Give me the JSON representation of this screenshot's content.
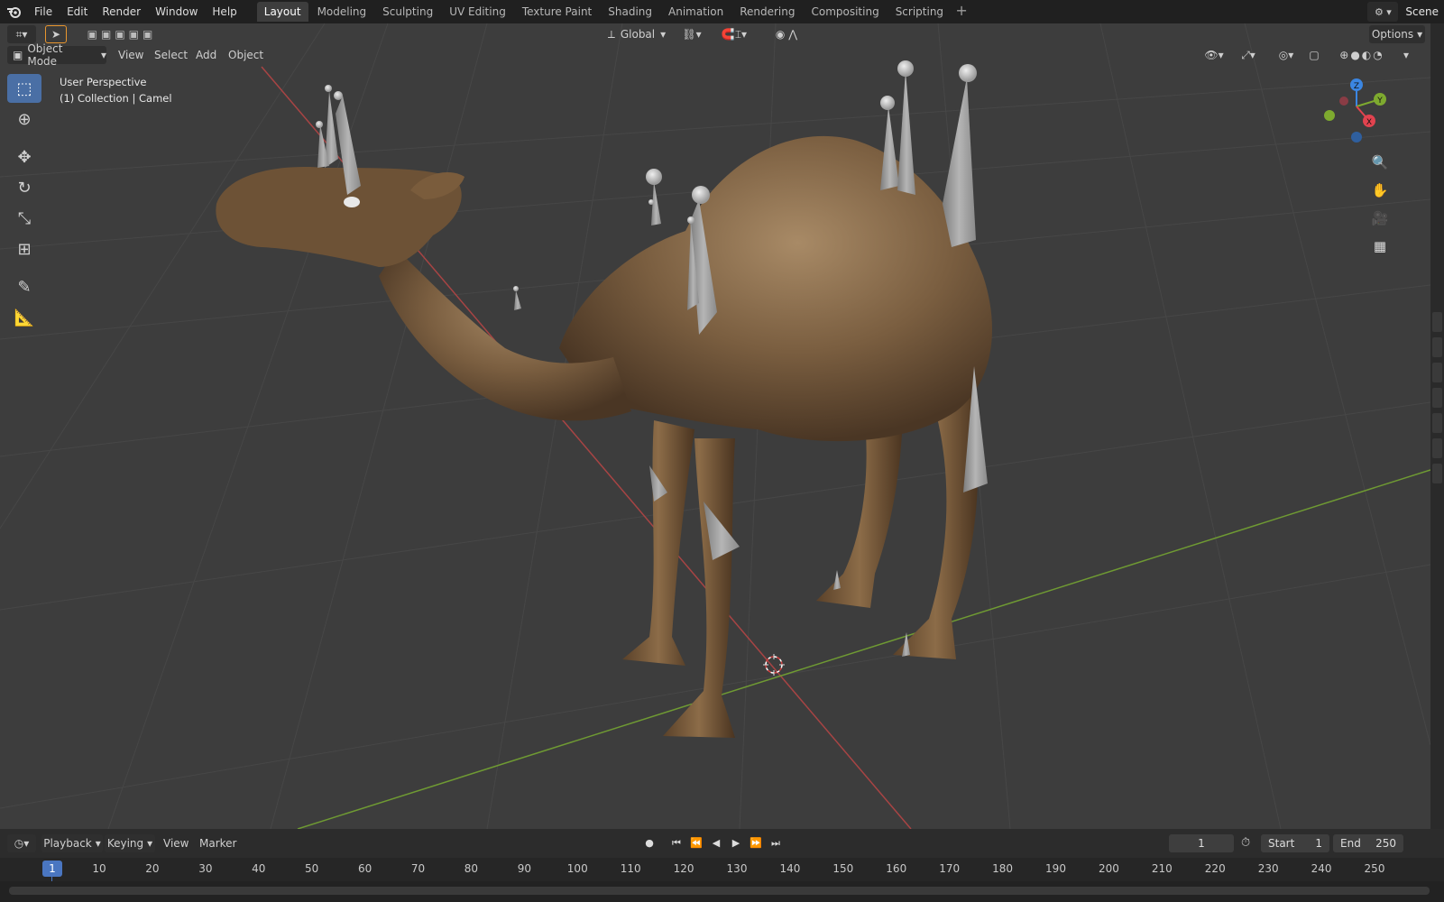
{
  "menubar": {
    "items": [
      "File",
      "Edit",
      "Render",
      "Window",
      "Help"
    ],
    "workspaces": [
      "Layout",
      "Modeling",
      "Sculpting",
      "UV Editing",
      "Texture Paint",
      "Shading",
      "Animation",
      "Rendering",
      "Compositing",
      "Scripting"
    ],
    "active_workspace": "Layout",
    "scene": "Scene"
  },
  "tool_header": {
    "orientation": "Global",
    "options": "Options"
  },
  "view_header": {
    "mode": "Object Mode",
    "menus": [
      "View",
      "Select",
      "Add",
      "Object"
    ]
  },
  "viewport": {
    "perspective": "User Perspective",
    "collection_info": "(1) Collection | Camel"
  },
  "gizmo": {
    "axes": [
      "Z",
      "Y",
      "X"
    ],
    "colors": {
      "x": "#e2434f",
      "y": "#7eaa2f",
      "z": "#3b86e2"
    }
  },
  "timeline": {
    "menus": [
      "Playback",
      "Keying",
      "View",
      "Marker"
    ],
    "current_frame": "1",
    "start_label": "Start",
    "start": "1",
    "end_label": "End",
    "end": "250",
    "ticks": [
      "1",
      "10",
      "20",
      "30",
      "40",
      "50",
      "60",
      "70",
      "80",
      "90",
      "100",
      "110",
      "120",
      "130",
      "140",
      "150",
      "160",
      "170",
      "180",
      "190",
      "200",
      "210",
      "220",
      "230",
      "240",
      "250"
    ]
  },
  "colors": {
    "accent": "#4a76c1",
    "x_axis": "#c84b4b",
    "y_axis": "#7fa83a"
  }
}
